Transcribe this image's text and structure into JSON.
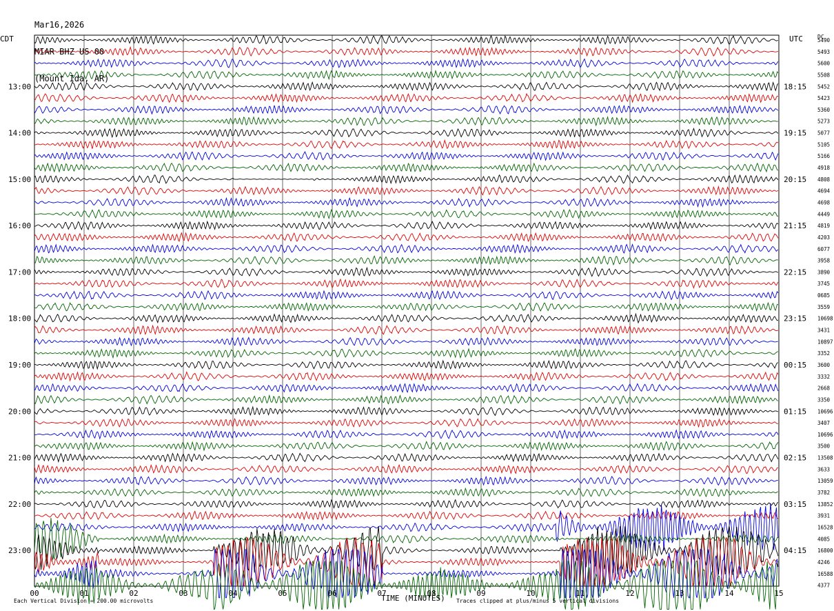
{
  "header": {
    "date": "Mar16,2026",
    "station": "MIAR BHZ US 00",
    "location": "(Mount Ida, AR)"
  },
  "axes": {
    "left_tz": "CDT",
    "right_tz": "UTC",
    "dc_label": "DC",
    "xlabel": "TIME (MINUTES)"
  },
  "footer": {
    "scale_note": "Each Vertical Division = 200.00 microvolts",
    "clip_note": "Traces clipped at plus/minus 5 vertical divisions"
  },
  "colors": {
    "trace_cycle": [
      "#000000",
      "#e00000",
      "#0000e0",
      "#006400"
    ],
    "grid": "#000000"
  },
  "chart_data": {
    "type": "line",
    "subtype": "helicorder",
    "title": "MIAR BHZ US 00",
    "xlabel": "TIME (MINUTES)",
    "xlim": [
      0,
      15
    ],
    "x_ticks": [
      "00",
      "01",
      "02",
      "03",
      "04",
      "05",
      "06",
      "07",
      "08",
      "09",
      "10",
      "11",
      "12",
      "13",
      "14",
      "15"
    ],
    "row_minutes": 15,
    "row_count": 48,
    "left_hour_labels": [
      "13:00",
      "14:00",
      "15:00",
      "16:00",
      "17:00",
      "18:00",
      "19:00",
      "20:00",
      "21:00",
      "22:00",
      "23:00"
    ],
    "right_hour_labels": [
      "18:15",
      "19:15",
      "20:15",
      "21:15",
      "22:15",
      "23:15",
      "00:15",
      "01:15",
      "02:15",
      "03:15",
      "04:15"
    ],
    "first_labeled_row": 4,
    "dc_offsets": [
      "5490",
      "5493",
      "5600",
      "5508",
      "5452",
      "5423",
      "5360",
      "5273",
      "5077",
      "5105",
      "5166",
      "4918",
      "4808",
      "4694",
      "4698",
      "4449",
      "4819",
      "4203",
      "6077",
      "3958",
      "3890",
      "3745",
      "0685",
      "3559",
      "10698",
      "3431",
      "10897",
      "3352",
      "3600",
      "3332",
      "2668",
      "3350",
      "10696",
      "3407",
      "10696",
      "3500",
      "13508",
      "3633",
      "13059",
      "3782",
      "13852",
      "3931",
      "16528",
      "4085",
      "16800",
      "4246",
      "16588",
      "4377"
    ],
    "trace_style": {
      "typical_amplitude_px": 5,
      "clip_divisions": 5,
      "quiet_gap": {
        "row": 12,
        "start_min": 4.0,
        "end_min": 5.6
      },
      "event_onset": {
        "start_row": 42,
        "start_min": 3.6,
        "note": "large clipped oscillations in final rows"
      }
    }
  }
}
